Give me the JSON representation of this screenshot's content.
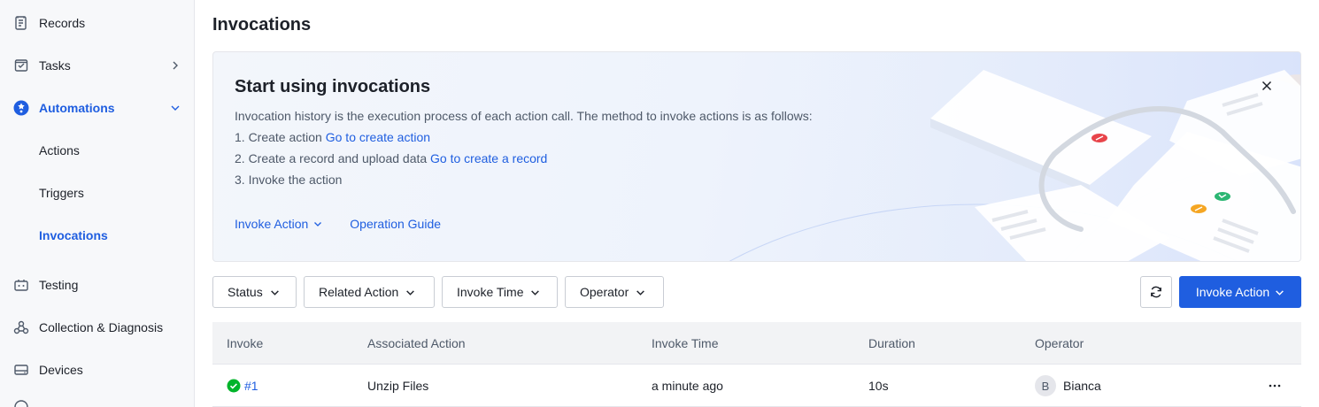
{
  "sidebar": {
    "items": [
      {
        "label": "Records",
        "icon": "records-icon"
      },
      {
        "label": "Tasks",
        "icon": "tasks-icon"
      },
      {
        "label": "Automations",
        "icon": "automations-icon"
      },
      {
        "label": "Actions"
      },
      {
        "label": "Triggers"
      },
      {
        "label": "Invocations"
      },
      {
        "label": "Testing",
        "icon": "testing-icon"
      },
      {
        "label": "Collection & Diagnosis",
        "icon": "collection-diagnosis-icon"
      },
      {
        "label": "Devices",
        "icon": "devices-icon"
      }
    ]
  },
  "page": {
    "title": "Invocations"
  },
  "banner": {
    "title": "Start using invocations",
    "description": "Invocation history is the execution process of each action call. The method to invoke actions is as follows:",
    "step1_text": "1. Create action ",
    "step1_link": "Go to create action",
    "step2_text": "2. Create a record and upload data ",
    "step2_link": "Go to create a record",
    "step3_text": "3. Invoke the action",
    "invoke_action_link": "Invoke Action",
    "operation_guide_link": "Operation Guide"
  },
  "filters": {
    "status": "Status",
    "related_action": "Related Action",
    "invoke_time": "Invoke Time",
    "operator": "Operator"
  },
  "toolbar": {
    "primary_label": "Invoke Action"
  },
  "table": {
    "columns": [
      "Invoke",
      "Associated Action",
      "Invoke Time",
      "Duration",
      "Operator"
    ],
    "rows": [
      {
        "id": "#1",
        "status": "success",
        "action": "Unzip Files",
        "time": "a minute ago",
        "duration": "10s",
        "operator_initial": "B",
        "operator": "Bianca"
      }
    ]
  },
  "colors": {
    "accent": "#1f5ee0",
    "success": "#00b42a",
    "sidebar_bg": "#f7f8fa"
  }
}
